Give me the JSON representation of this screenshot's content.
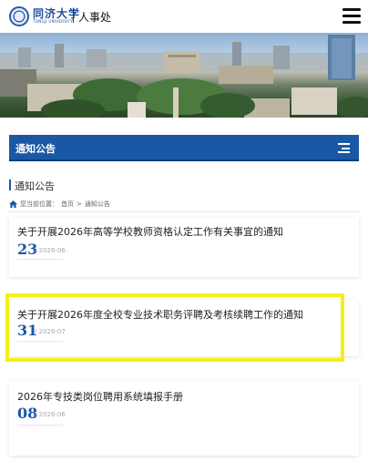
{
  "header": {
    "logo_cn": "同济大学",
    "logo_en": "TONGJI UNIVERSITY",
    "department": "人事处",
    "menu_icon": "hamburger-menu-icon"
  },
  "banner": {
    "alt": "campus-aerial-photo"
  },
  "section_bar": {
    "title": "通知公告",
    "icon": "list-menu-icon",
    "color": "#1a58a6"
  },
  "page": {
    "heading": "通知公告",
    "breadcrumb": {
      "prefix": "您当前位置：",
      "home": "首页",
      "separator": ">",
      "current": "通知公告"
    }
  },
  "notices": [
    {
      "title": "关于开展2026年高等学校教师资格认定工作有关事宜的通知",
      "day": "23",
      "year_month": "/ 2026-06"
    },
    {
      "title": "关于开展2026年度全校专业技术职务评聘及考核续聘工作的通知",
      "day": "31",
      "year_month": "/ 2026-07"
    },
    {
      "title": "2026年专技类岗位聘用系统填报手册",
      "day": "08",
      "year_month": "/ 2026-06"
    }
  ],
  "highlight_color": "#f4ef18"
}
